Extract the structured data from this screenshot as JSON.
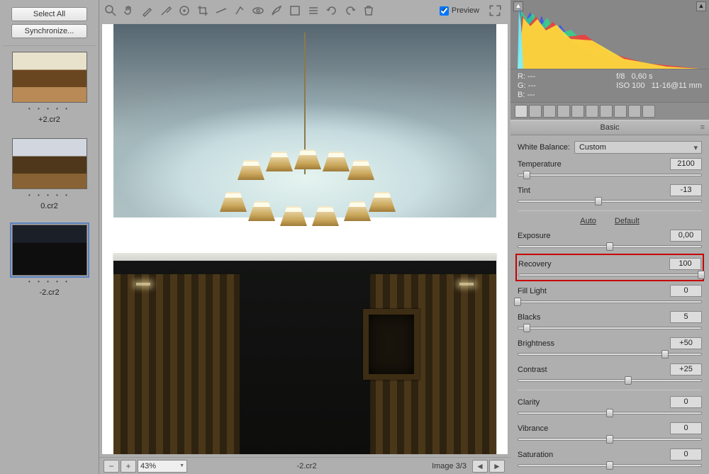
{
  "filmstrip": {
    "select_all": "Select All",
    "synchronize": "Synchronize...",
    "thumbs": [
      {
        "label": "+2.cr2"
      },
      {
        "label": "0.cr2"
      },
      {
        "label": "-2.cr2"
      }
    ]
  },
  "toolbar": {
    "preview_label": "Preview"
  },
  "bottombar": {
    "zoom": "43%",
    "filename": "-2.cr2",
    "pager": "Image 3/3"
  },
  "histogram_info": {
    "r": "R:   ---",
    "g": "G:   ---",
    "b": "B:   ---",
    "aperture": "f/8",
    "shutter": "0,60 s",
    "iso": "ISO 100",
    "lens": "11-16@11 mm"
  },
  "basic_panel": {
    "title": "Basic",
    "wb_label": "White Balance:",
    "wb_value": "Custom",
    "auto_label": "Auto",
    "default_label": "Default",
    "sliders": {
      "temperature": {
        "label": "Temperature",
        "value": "2100",
        "pos": 5
      },
      "tint": {
        "label": "Tint",
        "value": "-13",
        "pos": 44
      },
      "exposure": {
        "label": "Exposure",
        "value": "0,00",
        "pos": 50
      },
      "recovery": {
        "label": "Recovery",
        "value": "100",
        "pos": 100
      },
      "fill_light": {
        "label": "Fill Light",
        "value": "0",
        "pos": 0
      },
      "blacks": {
        "label": "Blacks",
        "value": "5",
        "pos": 5
      },
      "brightness": {
        "label": "Brightness",
        "value": "+50",
        "pos": 80
      },
      "contrast": {
        "label": "Contrast",
        "value": "+25",
        "pos": 60
      },
      "clarity": {
        "label": "Clarity",
        "value": "0",
        "pos": 50
      },
      "vibrance": {
        "label": "Vibrance",
        "value": "0",
        "pos": 50
      },
      "saturation": {
        "label": "Saturation",
        "value": "0",
        "pos": 50
      }
    }
  }
}
